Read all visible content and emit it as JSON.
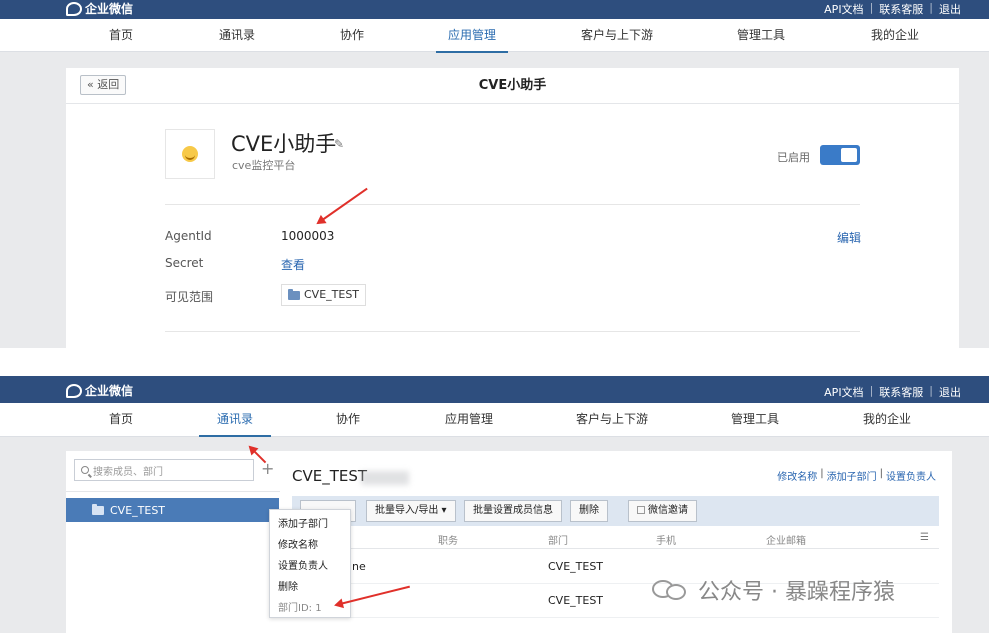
{
  "header": {
    "logo_text": "企业微信",
    "links": [
      "API文档",
      "联系客服",
      "退出"
    ],
    "separator": "|"
  },
  "nav": {
    "items": [
      "首页",
      "通讯录",
      "协作",
      "应用管理",
      "客户与上下游",
      "管理工具",
      "我的企业"
    ],
    "active_top": "应用管理",
    "active_bottom": "通讯录"
  },
  "app_detail": {
    "back_label": "« 返回",
    "page_title": "CVE小助手",
    "app_name": "CVE小助手",
    "app_desc": "cve监控平台",
    "status_label": "已启用",
    "enabled": true,
    "fields": [
      {
        "label": "AgentId",
        "value": "1000003"
      },
      {
        "label": "Secret",
        "value": "查看"
      },
      {
        "label": "可见范围",
        "value": "CVE_TEST"
      }
    ],
    "edit_label": "编辑"
  },
  "contacts": {
    "search_placeholder": "搜索成员、部门",
    "add_symbol": "+",
    "tree_item": "CVE_TEST",
    "dept_title": "CVE_TEST",
    "top_links": [
      "修改名称",
      "添加子部门",
      "设置负责人"
    ],
    "toolbar_buttons": [
      "批量导入/导出 ▾",
      "批量设置成员信息",
      "删除",
      "微信邀请"
    ],
    "columns": [
      "职务",
      "部门",
      "手机",
      "企业邮箱"
    ],
    "rows": [
      {
        "name": "ne",
        "dept": "CVE_TEST"
      },
      {
        "name": "",
        "dept": "CVE_TEST"
      }
    ],
    "context_menu": [
      "添加子部门",
      "修改名称",
      "设置负责人",
      "删除",
      "部门ID:  1"
    ]
  },
  "watermark": "公众号 · 暴躁程序猿",
  "colors": {
    "header_bg": "#2e4e7e",
    "accent": "#2a66b0",
    "arrow": "#e0302a"
  }
}
